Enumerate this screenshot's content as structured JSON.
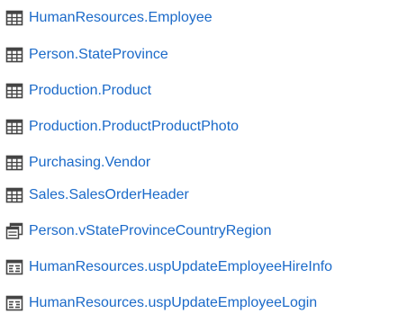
{
  "colors": {
    "link": "#1b6ac9",
    "icon": "#444444"
  },
  "items": [
    {
      "label": "HumanResources.Employee",
      "icon": "table-icon"
    },
    {
      "label": "Person.StateProvince",
      "icon": "table-icon"
    },
    {
      "label": "Production.Product",
      "icon": "table-icon"
    },
    {
      "label": "Production.ProductProductPhoto",
      "icon": "table-icon"
    },
    {
      "label": "Purchasing.Vendor",
      "icon": "table-icon"
    },
    {
      "label": "Sales.SalesOrderHeader",
      "icon": "table-icon"
    },
    {
      "label": "Person.vStateProvinceCountryRegion",
      "icon": "view-icon"
    },
    {
      "label": "HumanResources.uspUpdateEmployeeHireInfo",
      "icon": "stored-procedure-icon"
    },
    {
      "label": "HumanResources.uspUpdateEmployeeLogin",
      "icon": "stored-procedure-icon"
    }
  ]
}
